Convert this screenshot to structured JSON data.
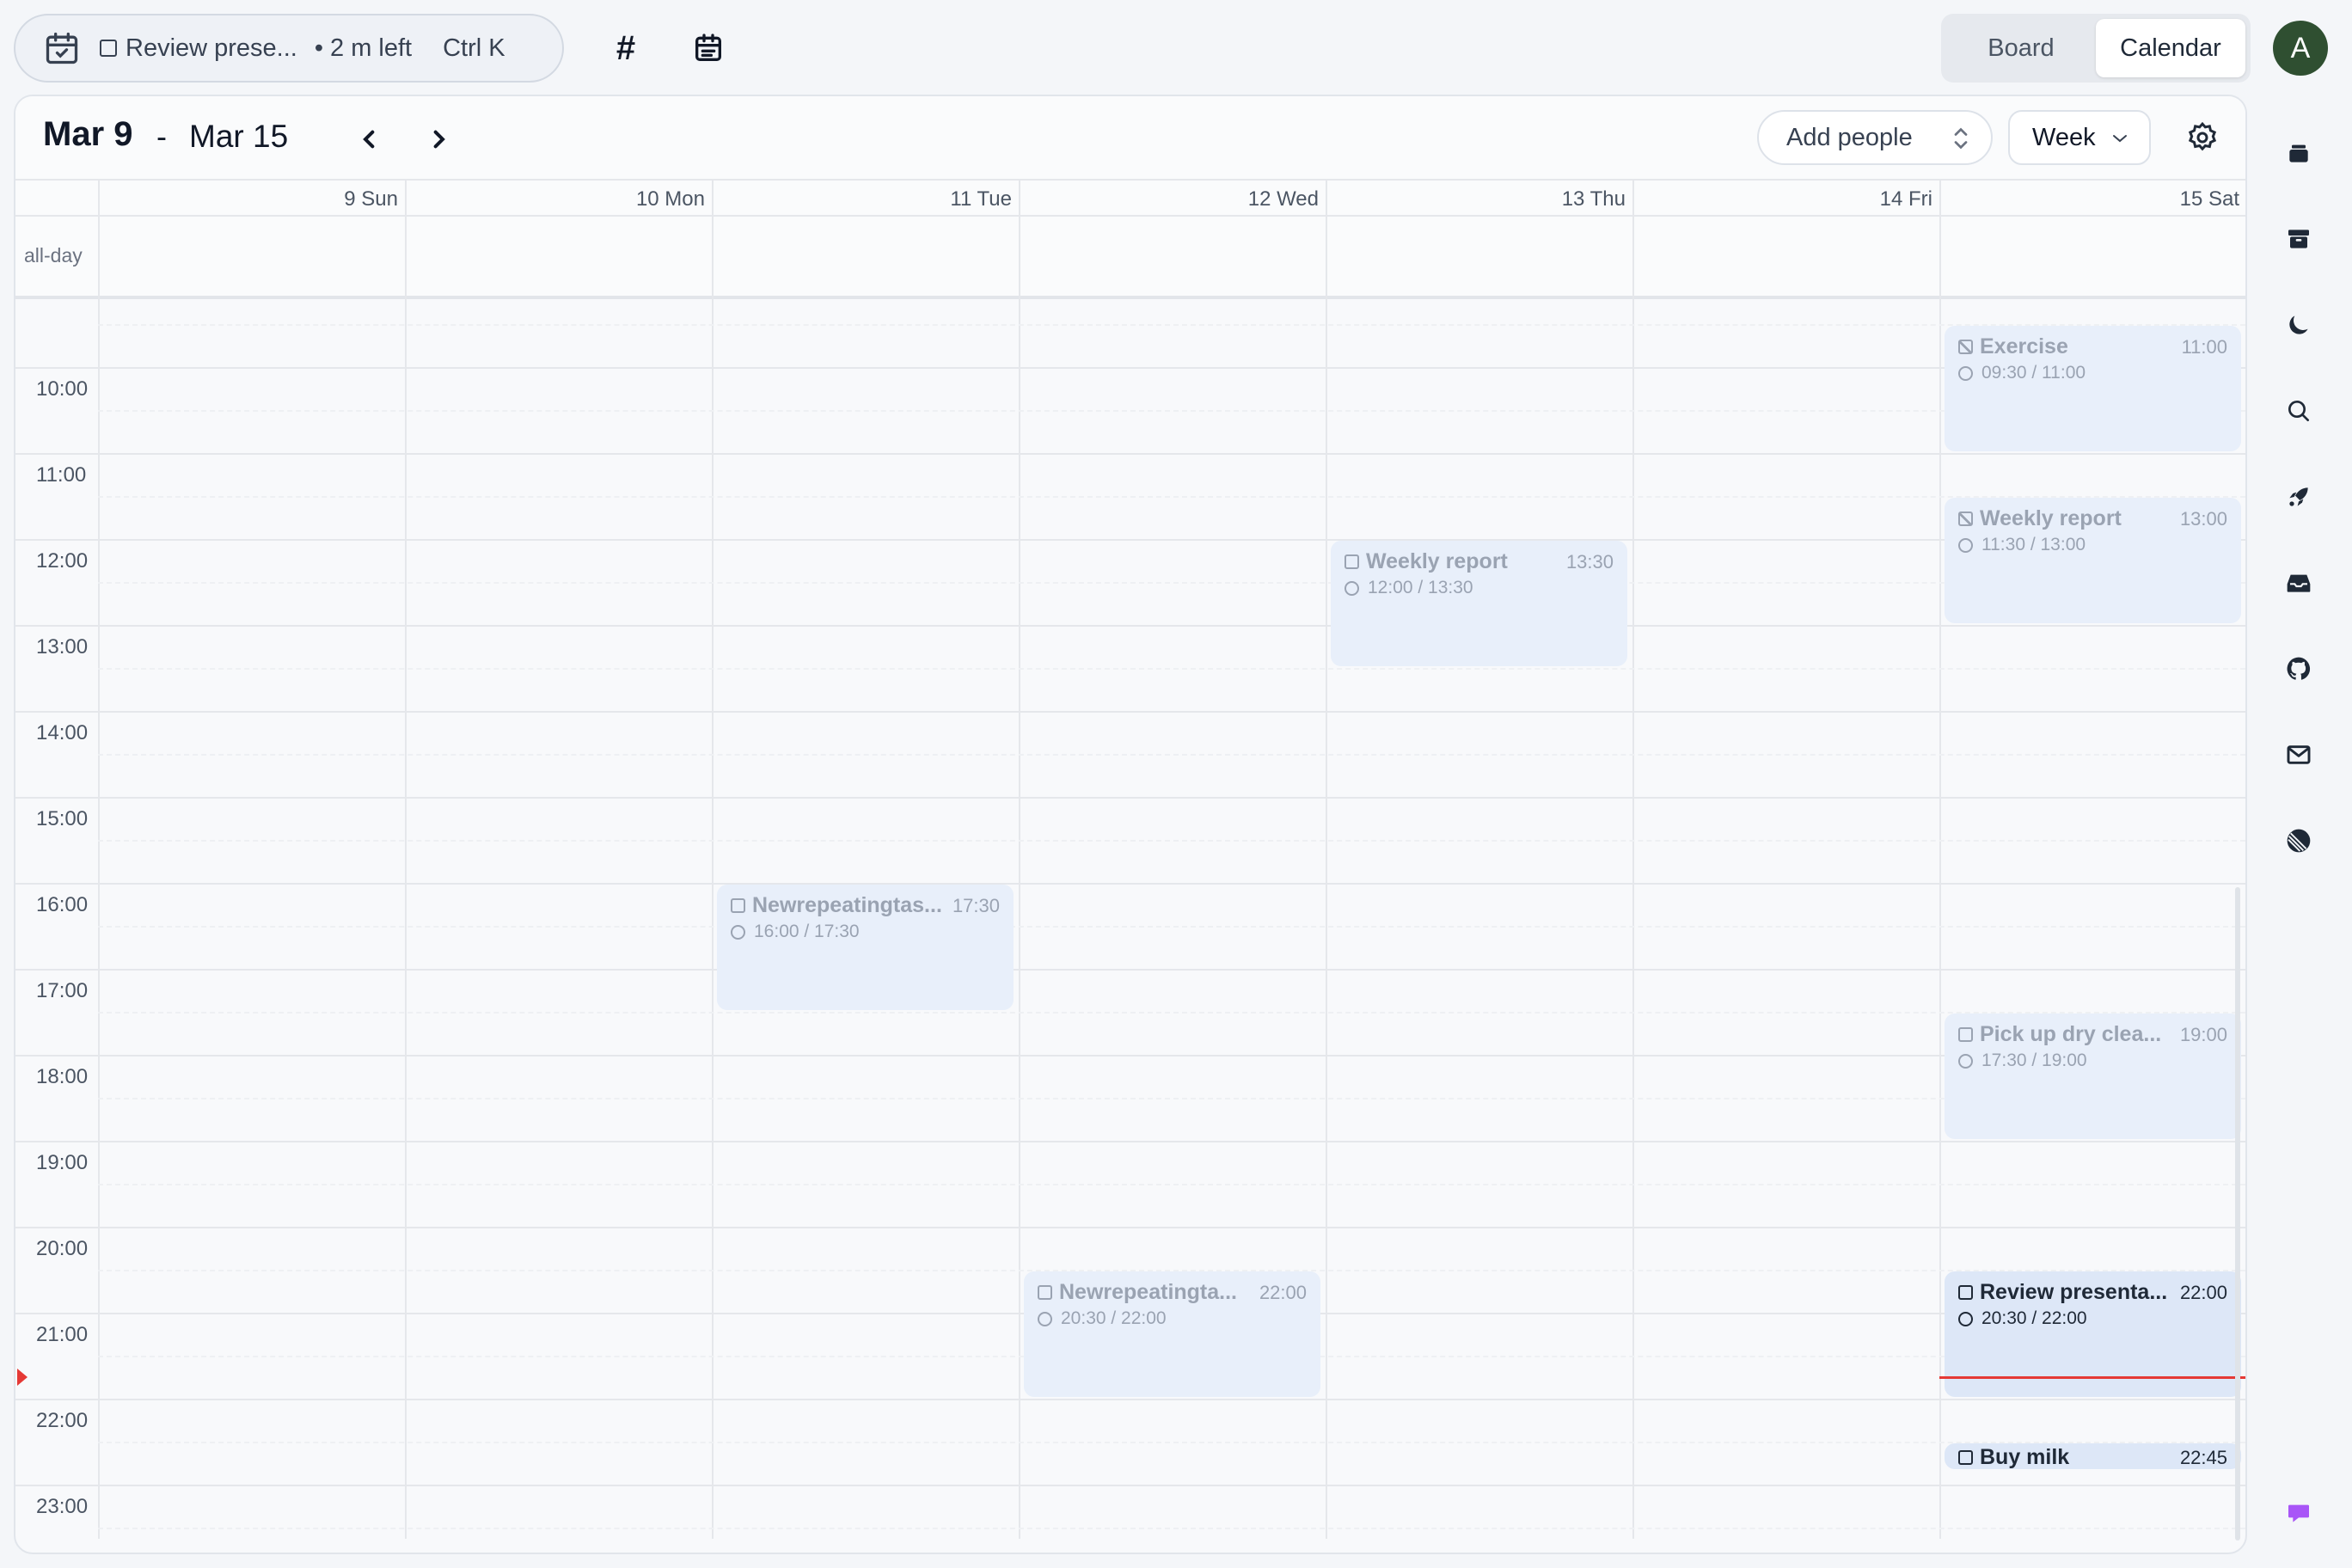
{
  "command_bar": {
    "current_task": "Review prese...",
    "time_left": "2 m left",
    "bullet": "•",
    "shortcut": "Ctrl K"
  },
  "toolbar": {
    "hash_icon": "hash-icon",
    "calendar_icon": "calendar-icon"
  },
  "view_toggle": {
    "board_label": "Board",
    "calendar_label": "Calendar",
    "active": "Calendar"
  },
  "avatar": {
    "initial": "A",
    "color": "#2f4f31"
  },
  "calendar": {
    "range_start": "Mar 9",
    "range_separator": "-",
    "range_end": "Mar 15",
    "prev_label": "‹",
    "next_label": "›",
    "add_people_label": "Add people",
    "view_label": "Week",
    "allday_label": "all-day",
    "days": [
      "9 Sun",
      "10 Mon",
      "11 Tue",
      "12 Wed",
      "13 Thu",
      "14 Fri",
      "15 Sat"
    ],
    "hours": [
      "10:00",
      "11:00",
      "12:00",
      "13:00",
      "14:00",
      "15:00",
      "16:00",
      "17:00",
      "18:00",
      "19:00",
      "20:00",
      "21:00",
      "22:00",
      "23:00"
    ],
    "now_time": "21:45",
    "events": [
      {
        "day": 6,
        "title": "Exercise",
        "end": "11:00",
        "time": "09:30 / 11:00",
        "start_h": 9.5,
        "end_h": 11.0,
        "done": true,
        "active": false
      },
      {
        "day": 6,
        "title": "Weekly report",
        "end": "13:00",
        "time": "11:30 / 13:00",
        "start_h": 11.5,
        "end_h": 13.0,
        "done": true,
        "active": false
      },
      {
        "day": 4,
        "title": "Weekly report",
        "end": "13:30",
        "time": "12:00 / 13:30",
        "start_h": 12.0,
        "end_h": 13.5,
        "done": false,
        "active": false
      },
      {
        "day": 2,
        "title": "Newrepeatingtas...",
        "end": "17:30",
        "time": "16:00 / 17:30",
        "start_h": 16.0,
        "end_h": 17.5,
        "done": false,
        "active": false
      },
      {
        "day": 6,
        "title": "Pick up dry clea...",
        "end": "19:00",
        "time": "17:30 / 19:00",
        "start_h": 17.5,
        "end_h": 19.0,
        "done": false,
        "active": false
      },
      {
        "day": 3,
        "title": "Newrepeatingta...",
        "end": "22:00",
        "time": "20:30 / 22:00",
        "start_h": 20.5,
        "end_h": 22.0,
        "done": false,
        "active": false
      },
      {
        "day": 6,
        "title": "Review presenta...",
        "end": "22:00",
        "time": "20:30 / 22:00",
        "start_h": 20.5,
        "end_h": 22.0,
        "done": false,
        "active": true
      },
      {
        "day": 6,
        "title": "Buy milk",
        "end": "22:45",
        "time": "",
        "start_h": 22.5,
        "end_h": 22.83,
        "done": false,
        "active": true
      }
    ]
  },
  "rail_icons": [
    "stack-icon",
    "archive-icon",
    "moon-icon",
    "search-icon",
    "rocket-icon",
    "inbox-icon",
    "github-icon",
    "mail-icon",
    "linear-icon",
    "chat-icon"
  ],
  "colors": {
    "accent_red": "#e53935",
    "event_bg": "#e8effa",
    "chat_purple": "#a855f7"
  }
}
